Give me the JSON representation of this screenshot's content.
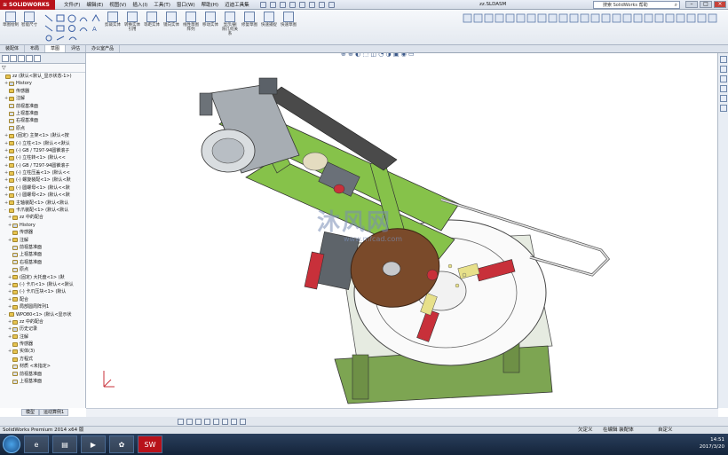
{
  "app": {
    "logo_text": "SOLIDWORKS",
    "doc_title": "zz.SLDASM",
    "search_placeholder": "搜索 SolidWorks 帮助"
  },
  "menu": [
    "文件(F)",
    "编辑(E)",
    "视图(V)",
    "插入(I)",
    "工具(T)",
    "窗口(W)",
    "帮助(H)",
    "迈迪工具集"
  ],
  "command_buttons": [
    "草图绘制",
    "智能尺寸",
    "剪裁实体",
    "转换实体引用",
    "等距实体",
    "镜向实体",
    "线性草图阵列",
    "移动实体",
    "显示/删除几何关系",
    "修复草图",
    "快速捕捉",
    "快速草图"
  ],
  "tabs": [
    "装配体",
    "布局",
    "草图",
    "评估",
    "办公室产品"
  ],
  "active_tab": "草图",
  "tree": [
    {
      "label": "zz  (默认<默认_显示状态-1>)",
      "exp": "",
      "color": "#e7c450"
    },
    {
      "label": "History",
      "exp": "+",
      "color": "#c9d6ea"
    },
    {
      "label": "传感器",
      "exp": "",
      "color": "#e7c450"
    },
    {
      "label": "注解",
      "exp": "+",
      "color": "#e7c450"
    },
    {
      "label": "前视基准面",
      "exp": "",
      "color": "#d9dfe8"
    },
    {
      "label": "上视基准面",
      "exp": "",
      "color": "#d9dfe8"
    },
    {
      "label": "右视基准面",
      "exp": "",
      "color": "#d9dfe8"
    },
    {
      "label": "原点",
      "exp": "",
      "color": "#d9dfe8"
    },
    {
      "label": "(固定) 主架<1> (默认<按",
      "exp": "+",
      "color": "#e7c450"
    },
    {
      "label": "(-) 立柱<1> (默认<<默认",
      "exp": "+",
      "color": "#e7c450"
    },
    {
      "label": "(-) GB / T297-94圆锥滚子",
      "exp": "+",
      "color": "#e7c450"
    },
    {
      "label": "(-) 立柱转<1> (默认<<",
      "exp": "+",
      "color": "#e7c450"
    },
    {
      "label": "(-) GB / T297-94圆锥滚子",
      "exp": "+",
      "color": "#e7c450"
    },
    {
      "label": "(-) 立柱压盖<1> (默认<<",
      "exp": "+",
      "color": "#e7c450"
    },
    {
      "label": "(-) 螺旋装配<1> (默认<默",
      "exp": "+",
      "color": "#e7c450"
    },
    {
      "label": "(-) 圆螺母<1> (默认<<默",
      "exp": "+",
      "color": "#e7c450"
    },
    {
      "label": "(-) 圆螺母<2> (默认<<默",
      "exp": "+",
      "color": "#e7c450"
    },
    {
      "label": "主轴装配<1> (默认<默认",
      "exp": "+",
      "color": "#e7c450"
    },
    {
      "label": "卡爪装配<1> (默认<默认",
      "exp": "-",
      "color": "#e7c450"
    },
    {
      "label": "zz 中的配合",
      "exp": "+",
      "color": "#e7c450"
    },
    {
      "label": "History",
      "exp": "+",
      "color": "#c9d6ea"
    },
    {
      "label": "传感器",
      "exp": "",
      "color": "#e7c450"
    },
    {
      "label": "注解",
      "exp": "+",
      "color": "#e7c450"
    },
    {
      "label": "前视基准面",
      "exp": "",
      "color": "#d9dfe8"
    },
    {
      "label": "上视基准面",
      "exp": "",
      "color": "#d9dfe8"
    },
    {
      "label": "右视基准面",
      "exp": "",
      "color": "#d9dfe8"
    },
    {
      "label": "原点",
      "exp": "",
      "color": "#d9dfe8"
    },
    {
      "label": "(固定) 大托盘<1> (默",
      "exp": "+",
      "color": "#e7c450"
    },
    {
      "label": "(-) 卡爪<1> (默认<<默认",
      "exp": "+",
      "color": "#e7c450"
    },
    {
      "label": "(-) 卡爪压块<1> (默认",
      "exp": "+",
      "color": "#e7c450"
    },
    {
      "label": "配合",
      "exp": "+",
      "color": "#e7c450"
    },
    {
      "label": "局部圆周阵列1",
      "exp": "+",
      "color": "#e7c450"
    },
    {
      "label": "WPO80<1> (默认<显示状",
      "exp": "-",
      "color": "#e7c450"
    },
    {
      "label": "zz 中的配合",
      "exp": "+",
      "color": "#e7c450"
    },
    {
      "label": "历史记录",
      "exp": "+",
      "color": "#c9d6ea"
    },
    {
      "label": "注解",
      "exp": "+",
      "color": "#e7c450"
    },
    {
      "label": "传感器",
      "exp": "",
      "color": "#e7c450"
    },
    {
      "label": "实体(3)",
      "exp": "+",
      "color": "#e7c450"
    },
    {
      "label": "方程式",
      "exp": "",
      "color": "#e7c450"
    },
    {
      "label": "材质 <未指定>",
      "exp": "",
      "color": "#d9dfe8"
    },
    {
      "label": "前视基准面",
      "exp": "",
      "color": "#d9dfe8"
    },
    {
      "label": "上视基准面",
      "exp": "",
      "color": "#d9dfe8"
    }
  ],
  "panel_tabs": [
    "模型",
    "运动算例1"
  ],
  "watermark": {
    "text": "沐风网",
    "url": "www.mfcad.com"
  },
  "status": {
    "left": "SolidWorks Premium 2014 x64 版",
    "s1": "欠定义",
    "s2": "在编辑 装配体",
    "s3": "自定义"
  },
  "clock": {
    "time": "14:51",
    "date": "2017/3/20"
  },
  "colors": {
    "frame_green": "#86c24a",
    "base_green": "#7da552",
    "motor_gray": "#8e959c",
    "brown_disc": "#7a4a2a",
    "red_part": "#c8303a",
    "brand_red": "#b8121a"
  }
}
